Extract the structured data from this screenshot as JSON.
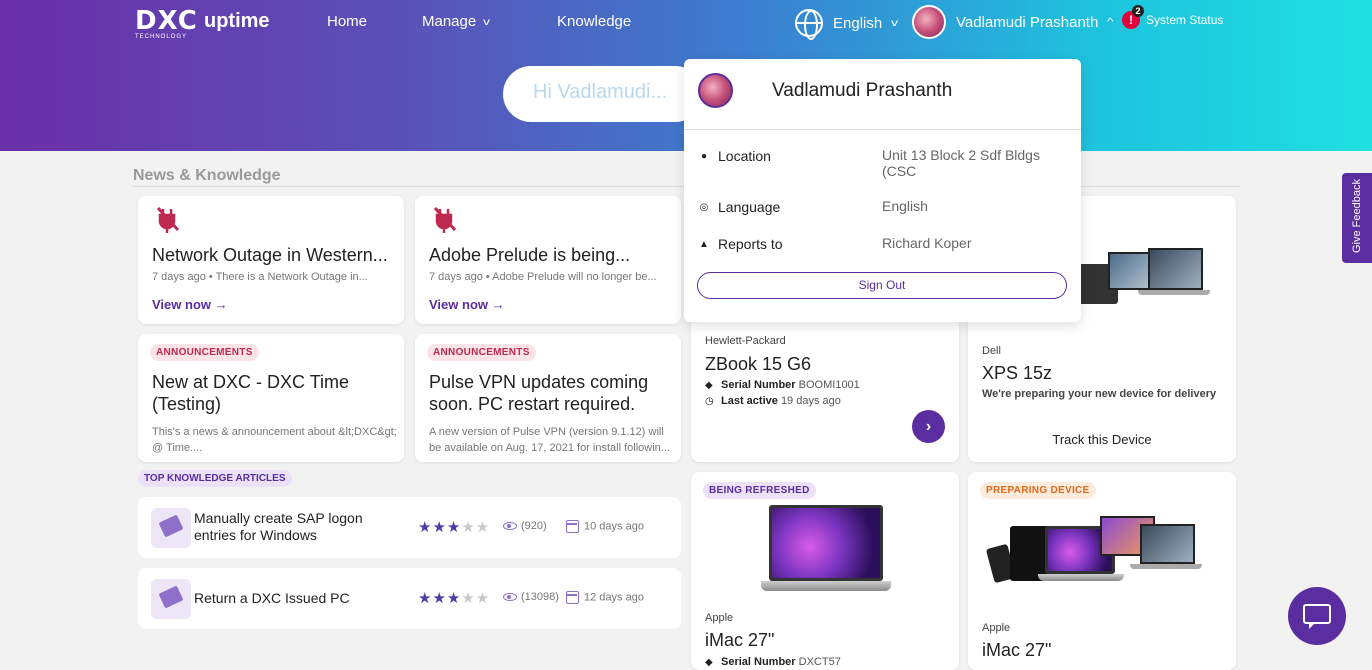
{
  "header": {
    "logo_main": "DXC",
    "logo_sub": "TECHNOLOGY",
    "product": "uptime",
    "nav": [
      "Home",
      "Manage",
      "Knowledge"
    ],
    "language": "English",
    "user_name": "Vadlamudi Prashanth",
    "status_count": "2",
    "status_label": "System Status"
  },
  "search": {
    "greeting": "Hi Vadlamudi..."
  },
  "news": {
    "section_title": "News & Knowledge",
    "outage_cards": [
      {
        "title": "Network Outage in Western...",
        "meta": "7 days ago • There is a Network Outage in...",
        "link": "View now"
      },
      {
        "title": "Adobe Prelude is being...",
        "meta": "7 days ago • Adobe Prelude will no longer be...",
        "link": "View now"
      }
    ],
    "announcements": [
      {
        "badge": "ANNOUNCEMENTS",
        "title": "New at DXC - DXC Time (Testing)",
        "desc": "This's a news & announcement about &lt;DXC&gt; @ Time...."
      },
      {
        "badge": "ANNOUNCEMENTS",
        "title": "Pulse VPN updates coming soon. PC restart required.",
        "desc": "A new version of Pulse VPN (version 9.1.12) will be available on Aug. 17, 2021 for install followin..."
      }
    ],
    "kb_label": "TOP KNOWLEDGE ARTICLES",
    "kb_articles": [
      {
        "title": "Manually create SAP logon entries for Windows",
        "rating": 3,
        "views": "(920)",
        "date": "10 days ago"
      },
      {
        "title": "Return a DXC Issued PC",
        "rating": 3,
        "views": "(13098)",
        "date": "12 days ago"
      }
    ]
  },
  "devices": [
    {
      "maker": "Hewlett-Packard",
      "model": "ZBook 15 G6",
      "serial_label": "Serial Number",
      "serial": "BOOMI1001",
      "active_label": "Last active",
      "active": "19 days ago"
    },
    {
      "maker": "Dell",
      "model": "XPS 15z",
      "note": "We're preparing your new device for delivery",
      "link": "Track this Device"
    },
    {
      "badge": "BEING REFRESHED",
      "maker": "Apple",
      "model": "iMac 27\"",
      "serial_label": "Serial Number",
      "serial": "DXCT57"
    },
    {
      "badge": "PREPARING DEVICE",
      "maker": "Apple",
      "model": "iMac 27\""
    }
  ],
  "dropdown": {
    "name": "Vadlamudi Prashanth",
    "location_label": "Location",
    "location": "Unit 13 Block 2 Sdf Bldgs (CSC",
    "language_label": "Language",
    "language": "English",
    "reports_label": "Reports to",
    "reports": "Richard Koper",
    "signout": "Sign Out"
  },
  "feedback": "Give Feedback",
  "colors": {
    "accent": "#5a2da0",
    "alert": "#e0003c"
  }
}
